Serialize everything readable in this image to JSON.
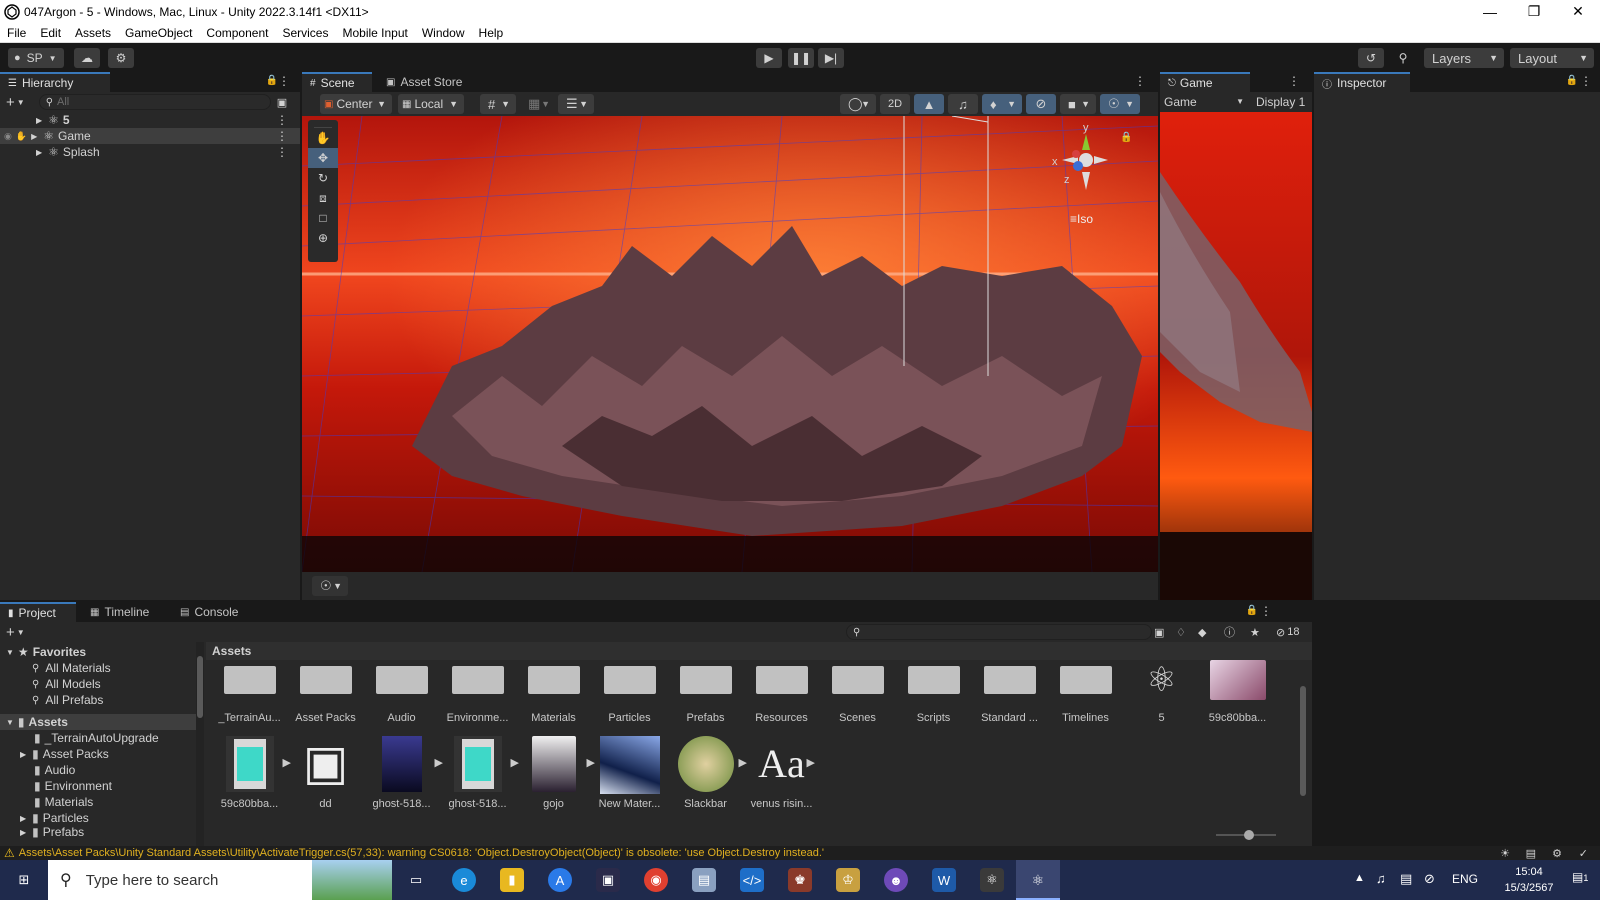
{
  "window": {
    "title": "047Argon - 5 - Windows, Mac, Linux - Unity 2022.3.14f1 <DX11>",
    "min_icon": "minimize-icon",
    "max_icon": "restore-icon",
    "close_icon": "close-icon"
  },
  "menu": [
    "File",
    "Edit",
    "Assets",
    "GameObject",
    "Component",
    "Services",
    "Mobile Input",
    "Window",
    "Help"
  ],
  "toolbar": {
    "account": "SP",
    "layers": "Layers",
    "layout": "Layout"
  },
  "hierarchy": {
    "tab": "Hierarchy",
    "search_placeholder": "All",
    "items": [
      "5",
      "Game",
      "Splash"
    ]
  },
  "scene": {
    "tabs": [
      "Scene",
      "Asset Store"
    ],
    "pivot": "Center",
    "space": "Local",
    "mode_2d": "2D",
    "gizmo_y": "y",
    "gizmo_x": "x",
    "gizmo_z": "z",
    "projection": "Iso"
  },
  "game": {
    "tab": "Game",
    "mode": "Game",
    "display": "Display 1"
  },
  "inspector": {
    "tab": "Inspector"
  },
  "bottom": {
    "tabs": [
      "Project",
      "Timeline",
      "Console"
    ],
    "hidden_count": "18",
    "breadcrumb": "Assets",
    "favorites": {
      "label": "Favorites",
      "items": [
        "All Materials",
        "All Models",
        "All Prefabs"
      ]
    },
    "assets_root": "Assets",
    "tree": [
      "_TerrainAutoUpgrade",
      "Asset Packs",
      "Audio",
      "Environment",
      "Materials",
      "Particles",
      "Prefabs"
    ],
    "folders": [
      "_TerrainAu...",
      "Asset Packs",
      "Audio",
      "Environme...",
      "Materials",
      "Particles",
      "Prefabs",
      "Resources",
      "Scenes",
      "Scripts",
      "Standard ...",
      "Timelines",
      "5",
      "59c80bba..."
    ],
    "items": [
      "59c80bba...",
      "dd",
      "ghost-518...",
      "ghost-518...",
      "gojo",
      "New Mater...",
      "Slackbar",
      "venus risin..."
    ]
  },
  "status": {
    "warning": "Assets\\Asset Packs\\Unity Standard Assets\\Utility\\ActivateTrigger.cs(57,33): warning CS0618: 'Object.DestroyObject(Object)' is obsolete: 'use Object.Destroy instead.'"
  },
  "taskbar": {
    "search_placeholder": "Type here to search",
    "lang": "ENG",
    "time": "15:04",
    "date": "15/3/2567",
    "notif": "1"
  },
  "colors": {
    "accent": "#3a79bb",
    "panel": "#282828",
    "dark": "#191919",
    "sky_red": "#d91a0a",
    "terrain": "#6e4a4e"
  }
}
